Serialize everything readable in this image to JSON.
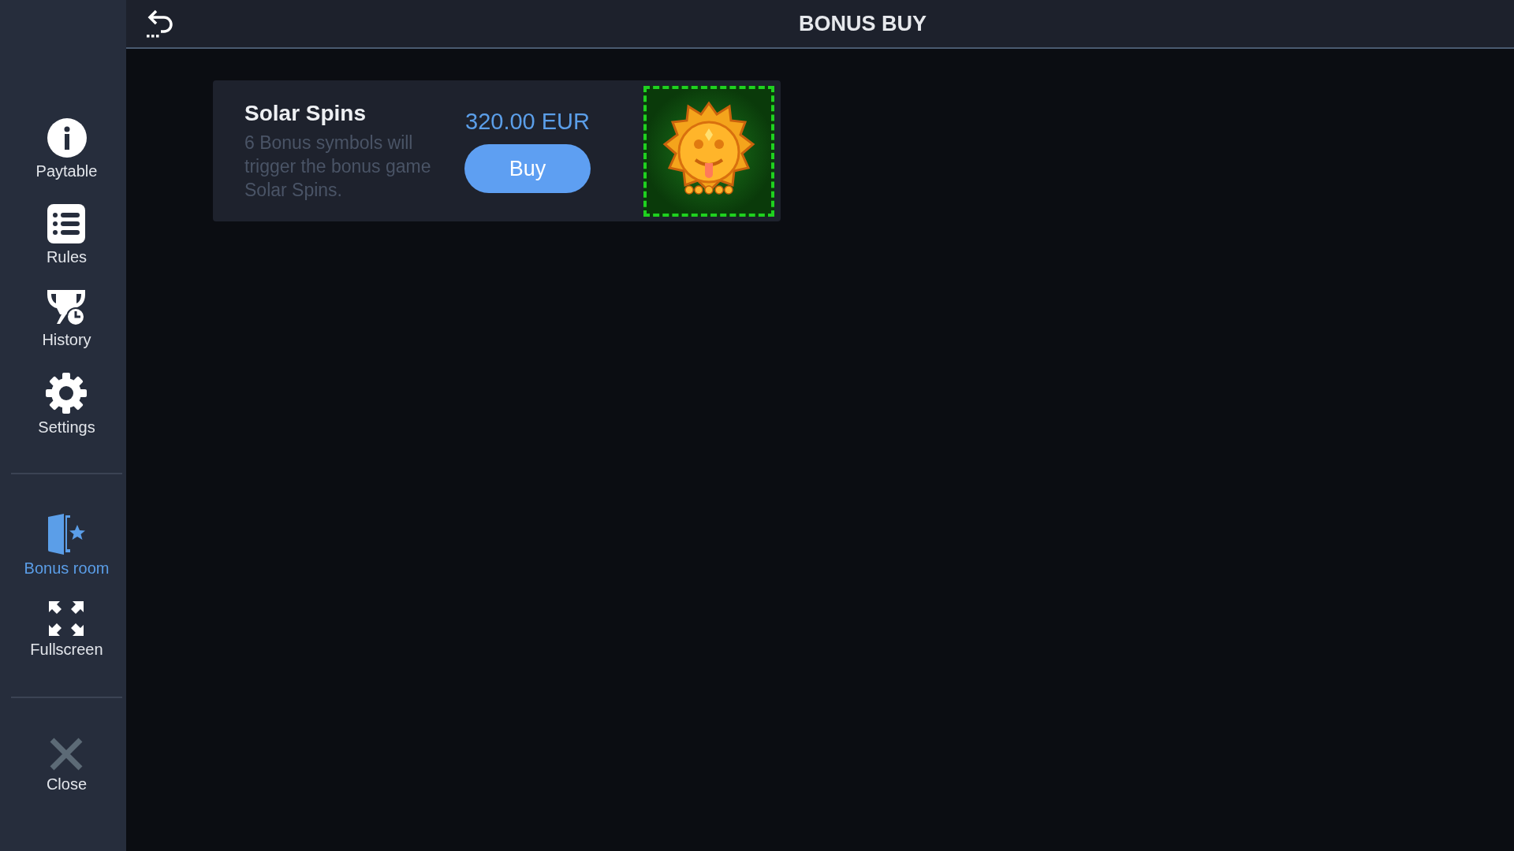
{
  "header": {
    "title": "BONUS BUY"
  },
  "sidebar": {
    "groups": [
      {
        "items": [
          {
            "kind": "info",
            "label": "Paytable",
            "selected": false
          },
          {
            "kind": "list",
            "label": "Rules",
            "selected": false
          },
          {
            "kind": "trophy",
            "label": "History",
            "selected": false
          },
          {
            "kind": "gear",
            "label": "Settings",
            "selected": false
          }
        ]
      },
      {
        "items": [
          {
            "kind": "door",
            "label": "Bonus room",
            "selected": true
          },
          {
            "kind": "expand",
            "label": "Fullscreen",
            "selected": false
          }
        ]
      },
      {
        "items": [
          {
            "kind": "close",
            "label": "Close",
            "selected": false
          }
        ]
      }
    ]
  },
  "offers": [
    {
      "title": "Solar Spins",
      "description": "6 Bonus symbols will trigger the bonus game Solar Spins.",
      "price": "320.00 EUR",
      "button": "Buy"
    }
  ]
}
